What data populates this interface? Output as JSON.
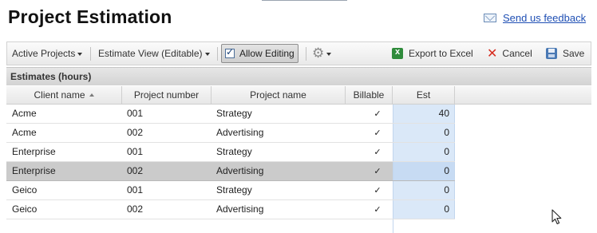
{
  "header": {
    "title": "Project Estimation",
    "feedback_label": "Send us feedback"
  },
  "toolbar": {
    "active_projects_label": "Active Projects",
    "estimate_view_label": "Estimate View (Editable)",
    "allow_editing_label": "Allow Editing",
    "allow_editing_checked": true,
    "export_label": "Export to Excel",
    "cancel_label": "Cancel",
    "save_label": "Save"
  },
  "section": {
    "title": "Estimates (hours)"
  },
  "grid": {
    "columns": [
      "Client name",
      "Project number",
      "Project name",
      "Billable",
      "Est"
    ],
    "sort_column": "Client name",
    "sort_direction": "ascending",
    "selected_row": 3,
    "rows": [
      {
        "client": "Acme",
        "number": "001",
        "project": "Strategy",
        "billable": "✓",
        "est": "40"
      },
      {
        "client": "Acme",
        "number": "002",
        "project": "Advertising",
        "billable": "✓",
        "est": "0"
      },
      {
        "client": "Enterprise",
        "number": "001",
        "project": "Strategy",
        "billable": "✓",
        "est": "0"
      },
      {
        "client": "Enterprise",
        "number": "002",
        "project": "Advertising",
        "billable": "✓",
        "est": "0"
      },
      {
        "client": "Geico",
        "number": "001",
        "project": "Strategy",
        "billable": "✓",
        "est": "0"
      },
      {
        "client": "Geico",
        "number": "002",
        "project": "Advertising",
        "billable": "✓",
        "est": "0"
      }
    ]
  },
  "colors": {
    "link": "#1f4fb4",
    "editable_cell": "#dae8f8",
    "selected_row": "#cbcbcb",
    "cancel_icon": "#d62b1e",
    "excel_icon": "#2f8b3b",
    "save_icon": "#4a79b4"
  }
}
